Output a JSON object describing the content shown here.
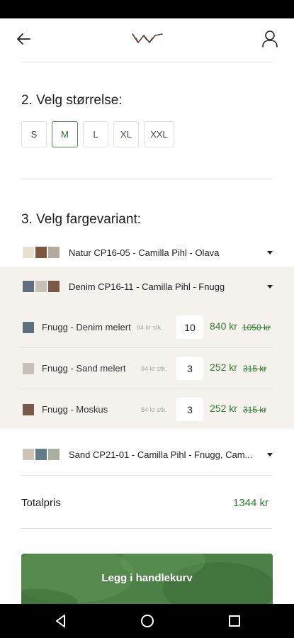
{
  "header": {
    "back_icon": "arrow-left-icon",
    "logo_icon": "brand-logo-icon",
    "user_icon": "user-icon"
  },
  "size_section": {
    "title": "2. Velg størrelse:",
    "sizes": [
      "S",
      "M",
      "L",
      "XL",
      "XXL"
    ],
    "selected": "M"
  },
  "color_section": {
    "title": "3. Velg fargevariant:",
    "variants": [
      {
        "name": "Natur CP16-05 - Camilla Pihl - Olava",
        "swatches": [
          "#e8e0cc",
          "#7d5640",
          "#b5aaa0"
        ],
        "expanded": false
      },
      {
        "name": "Denim CP16-11 - Camilla Pihl - Fnugg",
        "swatches": [
          "#5d6f80",
          "#c8bfb6",
          "#7c5848"
        ],
        "expanded": true
      },
      {
        "name": "Sand CP21-01 - Camilla Pihl - Fnugg, Cam...",
        "swatches": [
          "#cfc3b8",
          "#637c86",
          "#a9b0a0"
        ],
        "expanded": false
      }
    ],
    "yarns": [
      {
        "name": "Fnugg - Denim melert",
        "unit": "84 kr stk.",
        "qty": "10",
        "price": "840 kr",
        "old_price": "1050 kr",
        "swatch": "#5d6f80"
      },
      {
        "name": "Fnugg - Sand melert",
        "unit": "84 kr stk.",
        "qty": "3",
        "price": "252 kr",
        "old_price": "315 kr",
        "swatch": "#c8bfb6"
      },
      {
        "name": "Fnugg - Moskus",
        "unit": "84 kr stk.",
        "qty": "3",
        "price": "252 kr",
        "old_price": "315 kr",
        "swatch": "#7c5848"
      }
    ]
  },
  "total": {
    "label": "Totalpris",
    "value": "1344 kr"
  },
  "cart_button": {
    "label": "Legg i handlekurv"
  },
  "colors": {
    "accent_green": "#2f7a2f",
    "button_green": "#4a7e45",
    "expanded_bg": "#f5f2ee"
  },
  "nav": {
    "icons": [
      "back-triangle-icon",
      "home-circle-icon",
      "recents-square-icon"
    ]
  }
}
